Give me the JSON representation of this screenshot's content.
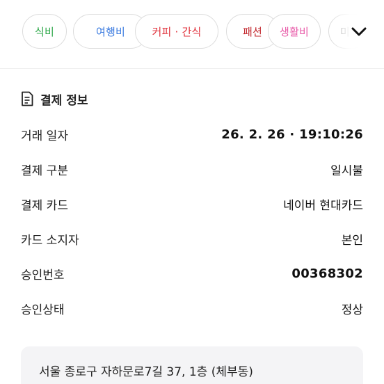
{
  "categories": [
    {
      "label": "식비",
      "color": "#2ea84a"
    },
    {
      "label": "여행비",
      "color": "#3b7be0"
    },
    {
      "label": "커피 · 간식",
      "color": "#e0323c"
    },
    {
      "label": "패션",
      "color": "#c2272d"
    },
    {
      "label": "생활비",
      "color": "#e85aa8"
    },
    {
      "label": "미",
      "color": "#9a9a9a"
    }
  ],
  "expand_icon": "chevron-down-icon",
  "payment_info": {
    "title": "결제 정보",
    "icon": "receipt-icon",
    "rows": [
      {
        "label": "거래 일자",
        "value": "26. 2. 26 · 19:10:26"
      },
      {
        "label": "결제 구분",
        "value": "일시불"
      },
      {
        "label": "결제 카드",
        "value": "네이버 현대카드"
      },
      {
        "label": "카드 소지자",
        "value": "본인"
      },
      {
        "label": "승인번호",
        "value": "00368302"
      },
      {
        "label": "승인상태",
        "value": "정상"
      }
    ]
  },
  "merchant": {
    "address": "서울 종로구 자하문로7길 37, 1층 (체부동)"
  }
}
